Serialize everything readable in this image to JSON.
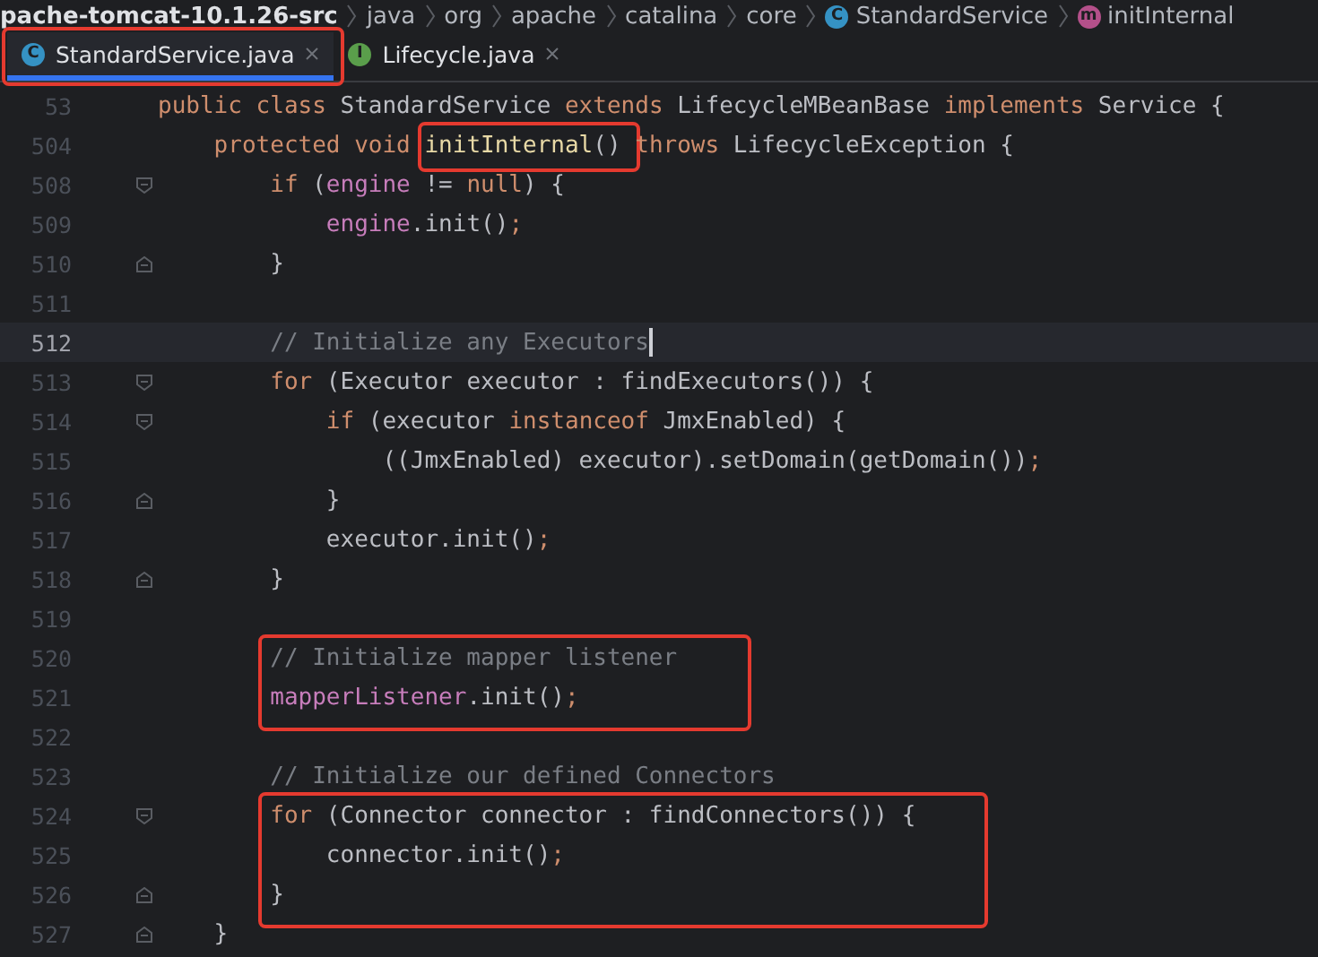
{
  "breadcrumbs": {
    "items": [
      {
        "text": "pache-tomcat-10.1.26-src",
        "kind": "root"
      },
      {
        "text": "java",
        "kind": "plain"
      },
      {
        "text": "org",
        "kind": "plain"
      },
      {
        "text": "apache",
        "kind": "plain"
      },
      {
        "text": "catalina",
        "kind": "plain"
      },
      {
        "text": "core",
        "kind": "plain"
      },
      {
        "text": "StandardService",
        "kind": "class",
        "badge": "C"
      },
      {
        "text": "initInternal",
        "kind": "method",
        "badge": "m"
      }
    ]
  },
  "tabs": [
    {
      "label": "StandardService.java",
      "badge": "C",
      "kind": "class",
      "selected": true,
      "outlined": true
    },
    {
      "label": "Lifecycle.java",
      "badge": "I",
      "kind": "interface",
      "selected": false,
      "outlined": false
    }
  ],
  "lines": [
    {
      "number": "53",
      "kind": "plain",
      "tokens": [
        {
          "kind": "kw",
          "text": "public class "
        },
        {
          "kind": "plain",
          "text": "StandardService "
        },
        {
          "kind": "kw",
          "text": "extends "
        },
        {
          "kind": "plain",
          "text": "LifecycleMBeanBase "
        },
        {
          "kind": "kw",
          "text": "implements "
        },
        {
          "kind": "plain",
          "text": "Service {"
        }
      ]
    },
    {
      "number": "504",
      "kind": "plain",
      "tokens": [
        {
          "kind": "kw",
          "text": "    protected void "
        },
        {
          "kind": "decl",
          "text": "initInternal",
          "outlined": true
        },
        {
          "kind": "plain",
          "text": "() "
        },
        {
          "kind": "kw",
          "text": "throws "
        },
        {
          "kind": "plain",
          "text": "LifecycleException {"
        }
      ]
    },
    {
      "number": "508",
      "kind": "fold_start",
      "tokens": [
        {
          "kind": "kw",
          "text": "        if "
        },
        {
          "kind": "plain",
          "text": "("
        },
        {
          "kind": "field",
          "text": "engine"
        },
        {
          "kind": "plain",
          "text": " != "
        },
        {
          "kind": "kw",
          "text": "null"
        },
        {
          "kind": "plain",
          "text": ") {"
        }
      ]
    },
    {
      "number": "509",
      "kind": "plain",
      "tokens": [
        {
          "kind": "field",
          "text": "            engine"
        },
        {
          "kind": "plain",
          "text": ".init()"
        },
        {
          "kind": "kw",
          "text": ";"
        }
      ]
    },
    {
      "number": "510",
      "kind": "fold_end",
      "tokens": [
        {
          "kind": "plain",
          "text": "        }"
        }
      ]
    },
    {
      "number": "511",
      "kind": "plain"
    },
    {
      "number": "512",
      "kind": "plain",
      "current": true,
      "tokens": [
        {
          "kind": "comment",
          "text": "        // Initialize any Executors"
        }
      ]
    },
    {
      "number": "513",
      "kind": "fold_start",
      "tokens": [
        {
          "kind": "kw",
          "text": "        for "
        },
        {
          "kind": "plain",
          "text": "(Executor executor : findExecutors()) {"
        }
      ]
    },
    {
      "number": "514",
      "kind": "fold_start",
      "tokens": [
        {
          "kind": "kw",
          "text": "            if "
        },
        {
          "kind": "plain",
          "text": "(executor "
        },
        {
          "kind": "kw",
          "text": "instanceof "
        },
        {
          "kind": "plain",
          "text": "JmxEnabled) {"
        }
      ]
    },
    {
      "number": "515",
      "kind": "plain",
      "tokens": [
        {
          "kind": "plain",
          "text": "                ((JmxEnabled) executor).setDomain(getDomain())"
        },
        {
          "kind": "kw",
          "text": ";"
        }
      ]
    },
    {
      "number": "516",
      "kind": "fold_end",
      "tokens": [
        {
          "kind": "plain",
          "text": "            }"
        }
      ]
    },
    {
      "number": "517",
      "kind": "plain",
      "tokens": [
        {
          "kind": "plain",
          "text": "            executor.init()"
        },
        {
          "kind": "kw",
          "text": ";"
        }
      ]
    },
    {
      "number": "518",
      "kind": "fold_end",
      "tokens": [
        {
          "kind": "plain",
          "text": "        }"
        }
      ]
    },
    {
      "number": "519",
      "kind": "plain"
    },
    {
      "number": "520",
      "kind": "plain",
      "boxed": true,
      "tokens": [
        {
          "kind": "comment",
          "text": "        // Initialize mapper listener"
        }
      ]
    },
    {
      "number": "521",
      "kind": "plain",
      "boxed": true,
      "tokens": [
        {
          "kind": "field",
          "text": "        mapperListener"
        },
        {
          "kind": "plain",
          "text": ".init()"
        },
        {
          "kind": "kw",
          "text": ";"
        }
      ]
    },
    {
      "number": "522",
      "kind": "plain"
    },
    {
      "number": "523",
      "kind": "plain",
      "tokens": [
        {
          "kind": "comment",
          "text": "        // Initialize our defined Connectors"
        }
      ]
    },
    {
      "number": "524",
      "kind": "fold_start",
      "boxed": true,
      "tokens": [
        {
          "kind": "kw",
          "text": "        for "
        },
        {
          "kind": "plain",
          "text": "(Connector connector : findConnectors()) {"
        }
      ]
    },
    {
      "number": "525",
      "kind": "plain",
      "boxed": true,
      "tokens": [
        {
          "kind": "plain",
          "text": "            connector.init()"
        },
        {
          "kind": "kw",
          "text": ";"
        }
      ]
    },
    {
      "number": "526",
      "kind": "fold_end",
      "boxed": true,
      "tokens": [
        {
          "kind": "plain",
          "text": "        }"
        }
      ]
    },
    {
      "number": "527",
      "kind": "fold_end",
      "tokens": [
        {
          "kind": "plain",
          "text": "    }"
        }
      ]
    }
  ]
}
